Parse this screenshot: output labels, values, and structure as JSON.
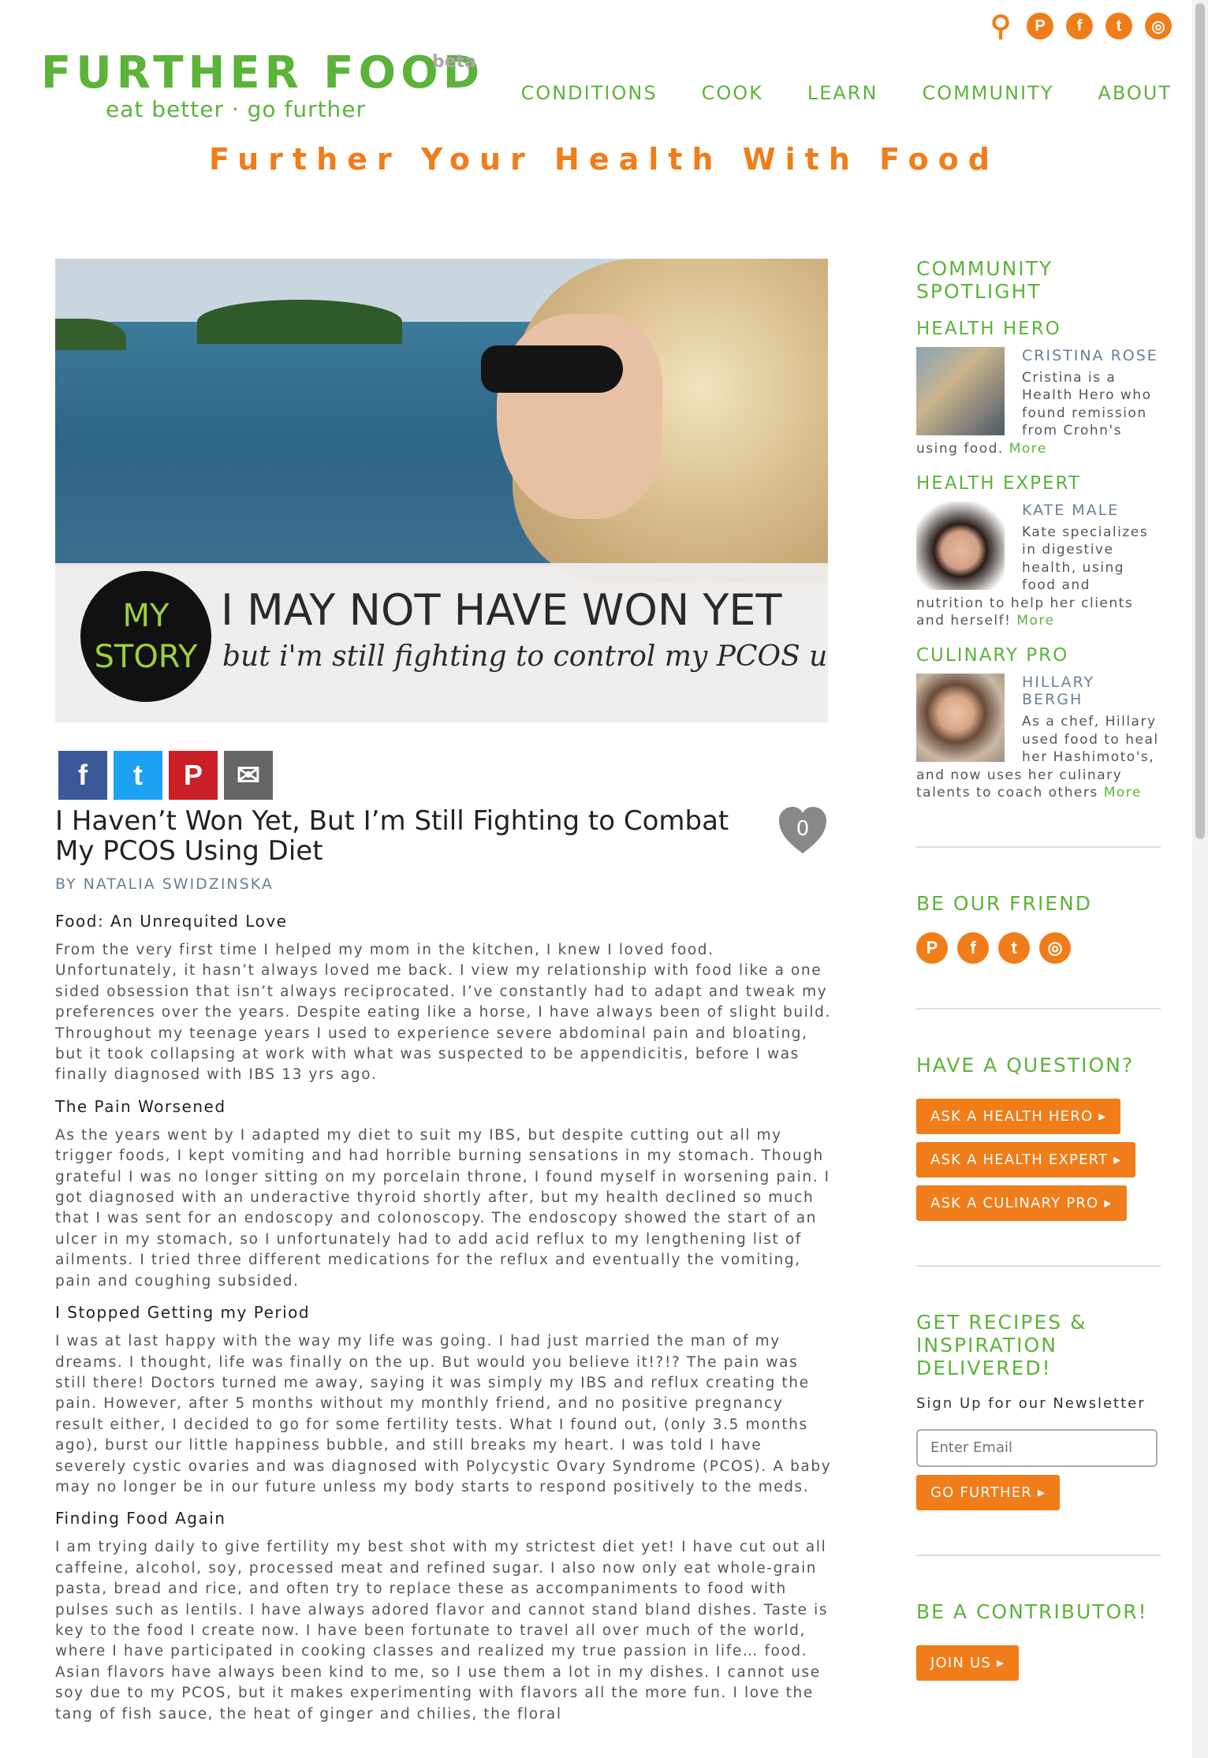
{
  "header": {
    "logo_title": "FURTHER FOOD",
    "logo_beta": "beta",
    "logo_tagline": "eat better · go further",
    "nav": [
      "CONDITIONS",
      "COOK",
      "LEARN",
      "COMMUNITY",
      "ABOUT"
    ],
    "tagline": "Further Your Health With Food",
    "icons": [
      "search-icon",
      "pinterest-icon",
      "facebook-icon",
      "twitter-icon",
      "instagram-icon"
    ]
  },
  "hero": {
    "badge_line1": "MY",
    "badge_line2": "STORY",
    "headline": "I MAY NOT HAVE WON YET",
    "subline": "but i'm still fighting to control my PCOS using d"
  },
  "share": [
    "facebook-icon",
    "twitter-icon",
    "pinterest-icon",
    "email-icon"
  ],
  "article": {
    "title": "I Haven’t Won Yet, But I’m Still Fighting to Combat My PCOS Using Diet",
    "likes": "0",
    "byline": "BY NATALIA SWIDZINSKA",
    "sections": [
      {
        "heading": "Food: An Unrequited Love",
        "text": "From the very first time I helped my mom in the kitchen, I knew I loved food. Unfortunately, it hasn’t always loved me back. I view my relationship with food like a one sided obsession that isn’t always reciprocated. I’ve constantly had to adapt and tweak my preferences over the years.  Despite eating like a horse, I have always been of slight build. Throughout my teenage years I used to experience severe abdominal pain and bloating, but it took collapsing at work with what was suspected to be appendicitis, before I was finally diagnosed with IBS 13 yrs ago."
      },
      {
        "heading": "The Pain Worsened",
        "text": "As the years went by I adapted my diet to suit my IBS, but despite cutting out all my trigger foods, I kept vomiting and had horrible burning sensations in my stomach. Though grateful I was no longer sitting on my porcelain throne, I found myself in worsening pain. I got diagnosed with an underactive thyroid shortly after, but my health declined so much that I was sent for an endoscopy and colonoscopy. The endoscopy showed the start of an ulcer in my stomach, so I unfortunately had to add acid reflux to my lengthening list of ailments. I tried three different medications for the reflux and eventually the vomiting, pain and coughing subsided."
      },
      {
        "heading": "I Stopped Getting my Period",
        "text": "I was at last happy with the way my life was going. I had just married the man of my dreams. I thought, life was finally on the up. But would you believe it!?!? The pain was still there! Doctors turned me away, saying it was simply my IBS and reflux creating the pain. However, after 5 months without my monthly friend, and no positive pregnancy result either, I decided to go for some fertility tests. What I found out, (only 3.5 months ago), burst our little happiness bubble, and still breaks my heart. I was told I have severely cystic ovaries and was diagnosed with Polycystic Ovary Syndrome (PCOS). A baby may no longer be in our future unless my body starts to respond positively to the meds."
      },
      {
        "heading": "Finding Food Again",
        "text": "I am trying daily to give fertility my best shot with my strictest diet yet! I have cut out all caffeine, alcohol, soy, processed meat and refined sugar. I also now only eat whole-grain pasta, bread and rice, and often try to replace these as accompaniments to food with pulses such as lentils. I have always adored flavor and cannot stand bland dishes. Taste is key to the food I create now. I have been fortunate to travel all over much of the world, where I have participated in cooking classes and realized my true passion in life… food. Asian flavors have always been kind to me, so I use them a lot in my dishes.  I cannot use soy due to my PCOS, but it makes experimenting with flavors all the more fun. I love the tang of fish sauce, the heat of ginger and chilies, the floral"
      }
    ]
  },
  "sidebar": {
    "spotlight_title": "COMMUNITY SPOTLIGHT",
    "people": [
      {
        "role": "HEALTH HERO",
        "name": "CRISTINA ROSE",
        "desc": "Cristina is a Health Hero who found remission from Crohn's using food.",
        "more": "More"
      },
      {
        "role": "HEALTH EXPERT",
        "name": "KATE MALE",
        "desc": "Kate specializes in digestive health, using food and nutrition to help her clients and herself!",
        "more": "More"
      },
      {
        "role": "CULINARY PRO",
        "name": "HILLARY BERGH",
        "desc": "As a chef, Hillary used food to heal her Hashimoto's, and now uses her culinary talents to coach others",
        "more": "More"
      }
    ],
    "friend_title": "BE OUR FRIEND",
    "friend_icons": [
      "pinterest-icon",
      "facebook-icon",
      "twitter-icon",
      "instagram-icon"
    ],
    "question_title": "HAVE A QUESTION?",
    "question_buttons": [
      "ASK A HEALTH HERO",
      "ASK A HEALTH EXPERT",
      "ASK A CULINARY PRO"
    ],
    "newsletter_title": "GET RECIPES & INSPIRATION DELIVERED!",
    "newsletter_text": "Sign Up for our Newsletter",
    "email_placeholder": "Enter Email",
    "newsletter_button": "GO FURTHER",
    "contributor_title": "BE A CONTRIBUTOR!",
    "contributor_button": "JOIN US"
  },
  "colors": {
    "green": "#5cb33a",
    "orange": "#f07d1a",
    "slate": "#6a7f96"
  }
}
